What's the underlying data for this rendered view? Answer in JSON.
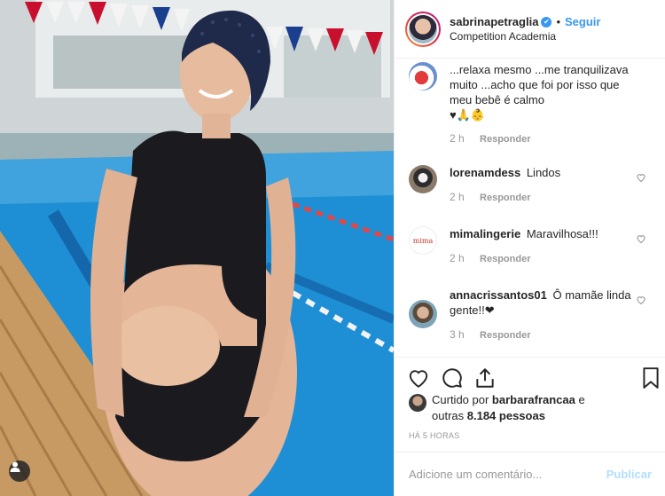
{
  "post": {
    "username": "sabrinapetraglia",
    "follow_label": "Seguir",
    "dot": "•",
    "location": "Competition Academia",
    "verified_mark": "✔"
  },
  "comments": [
    {
      "user": "",
      "text": "...relaxa mesmo ...me tranquilizava muito ...acho que foi por isso que meu bebê é calmo",
      "emoji": "♥🙏👶",
      "time": "2 h",
      "reply": "Responder"
    },
    {
      "user": "lorenamdess",
      "text": "Lindos",
      "time": "2 h",
      "reply": "Responder"
    },
    {
      "user": "mimalingerie",
      "text": "Maravilhosa!!!",
      "time": "2 h",
      "reply": "Responder",
      "avatar_text": "mima"
    },
    {
      "user": "annacrissantos01",
      "text": "Ô mamãe linda gente!!❤",
      "time": "3 h",
      "reply": "Responder"
    }
  ],
  "likes": {
    "prefix": "Curtido por ",
    "user": "barbarafrancaa",
    "suffix": " e outras ",
    "count": "8.184 pessoas"
  },
  "timestamp": "HÁ 5 HORAS",
  "add_comment": {
    "placeholder": "Adicione um comentário...",
    "publish": "Publicar"
  },
  "icons": [
    "heart-icon",
    "comment-icon",
    "share-icon",
    "bookmark-icon",
    "like-comment-icon",
    "user-tag-icon"
  ],
  "colors": {
    "accent": "#3897f0",
    "publish_disabled": "#b2dffc",
    "muted": "#999999"
  }
}
